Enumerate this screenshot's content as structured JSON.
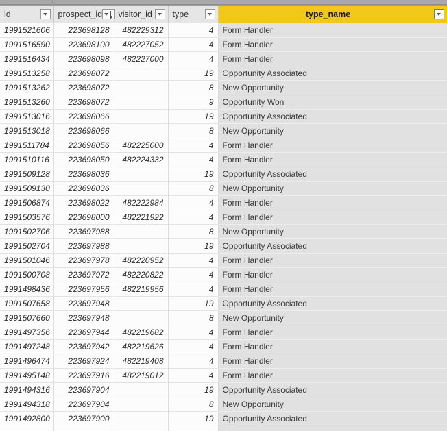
{
  "window": {
    "top_bar_segments": [
      "tab-strip-left",
      "tab-strip-right"
    ]
  },
  "grid": {
    "columns": [
      {
        "key": "id",
        "label": "id",
        "align": "right",
        "italic": true,
        "filter_icon": "filter-caret-icon",
        "highlighted": false
      },
      {
        "key": "prospect_id",
        "label": "prospect_id",
        "align": "right",
        "italic": true,
        "filter_icon": "filter-sort-descending-icon",
        "highlighted": false
      },
      {
        "key": "visitor_id",
        "label": "visitor_id",
        "align": "right",
        "italic": true,
        "filter_icon": "filter-caret-icon",
        "highlighted": false
      },
      {
        "key": "type",
        "label": "type",
        "align": "right",
        "italic": true,
        "filter_icon": "filter-caret-icon",
        "highlighted": false
      },
      {
        "key": "type_name",
        "label": "type_name",
        "align": "left",
        "italic": false,
        "filter_icon": "filter-caret-icon",
        "highlighted": true
      }
    ],
    "highlight_color": "#f0c817",
    "header_color": "#e6e6e6",
    "selected_column_cell_color": "#e1e1e1",
    "rows": [
      {
        "id": "1991521606",
        "prospect_id": "223698128",
        "visitor_id": "482229312",
        "type": "4",
        "type_name": "Form Handler"
      },
      {
        "id": "1991516590",
        "prospect_id": "223698100",
        "visitor_id": "482227052",
        "type": "4",
        "type_name": "Form Handler"
      },
      {
        "id": "1991516434",
        "prospect_id": "223698098",
        "visitor_id": "482227000",
        "type": "4",
        "type_name": "Form Handler"
      },
      {
        "id": "1991513258",
        "prospect_id": "223698072",
        "visitor_id": "",
        "type": "19",
        "type_name": "Opportunity Associated"
      },
      {
        "id": "1991513262",
        "prospect_id": "223698072",
        "visitor_id": "",
        "type": "8",
        "type_name": "New Opportunity"
      },
      {
        "id": "1991513260",
        "prospect_id": "223698072",
        "visitor_id": "",
        "type": "9",
        "type_name": "Opportunity Won"
      },
      {
        "id": "1991513016",
        "prospect_id": "223698066",
        "visitor_id": "",
        "type": "19",
        "type_name": "Opportunity Associated"
      },
      {
        "id": "1991513018",
        "prospect_id": "223698066",
        "visitor_id": "",
        "type": "8",
        "type_name": "New Opportunity"
      },
      {
        "id": "1991511784",
        "prospect_id": "223698056",
        "visitor_id": "482225000",
        "type": "4",
        "type_name": "Form Handler"
      },
      {
        "id": "1991510116",
        "prospect_id": "223698050",
        "visitor_id": "482224332",
        "type": "4",
        "type_name": "Form Handler"
      },
      {
        "id": "1991509128",
        "prospect_id": "223698036",
        "visitor_id": "",
        "type": "19",
        "type_name": "Opportunity Associated"
      },
      {
        "id": "1991509130",
        "prospect_id": "223698036",
        "visitor_id": "",
        "type": "8",
        "type_name": "New Opportunity"
      },
      {
        "id": "1991506874",
        "prospect_id": "223698022",
        "visitor_id": "482222984",
        "type": "4",
        "type_name": "Form Handler"
      },
      {
        "id": "1991503576",
        "prospect_id": "223698000",
        "visitor_id": "482221922",
        "type": "4",
        "type_name": "Form Handler"
      },
      {
        "id": "1991502706",
        "prospect_id": "223697988",
        "visitor_id": "",
        "type": "8",
        "type_name": "New Opportunity"
      },
      {
        "id": "1991502704",
        "prospect_id": "223697988",
        "visitor_id": "",
        "type": "19",
        "type_name": "Opportunity Associated"
      },
      {
        "id": "1991501046",
        "prospect_id": "223697978",
        "visitor_id": "482220952",
        "type": "4",
        "type_name": "Form Handler"
      },
      {
        "id": "1991500708",
        "prospect_id": "223697972",
        "visitor_id": "482220822",
        "type": "4",
        "type_name": "Form Handler"
      },
      {
        "id": "1991498436",
        "prospect_id": "223697956",
        "visitor_id": "482219956",
        "type": "4",
        "type_name": "Form Handler"
      },
      {
        "id": "1991507658",
        "prospect_id": "223697948",
        "visitor_id": "",
        "type": "19",
        "type_name": "Opportunity Associated"
      },
      {
        "id": "1991507660",
        "prospect_id": "223697948",
        "visitor_id": "",
        "type": "8",
        "type_name": "New Opportunity"
      },
      {
        "id": "1991497356",
        "prospect_id": "223697944",
        "visitor_id": "482219682",
        "type": "4",
        "type_name": "Form Handler"
      },
      {
        "id": "1991497248",
        "prospect_id": "223697942",
        "visitor_id": "482219626",
        "type": "4",
        "type_name": "Form Handler"
      },
      {
        "id": "1991496474",
        "prospect_id": "223697924",
        "visitor_id": "482219408",
        "type": "4",
        "type_name": "Form Handler"
      },
      {
        "id": "1991495148",
        "prospect_id": "223697916",
        "visitor_id": "482219012",
        "type": "4",
        "type_name": "Form Handler"
      },
      {
        "id": "1991494316",
        "prospect_id": "223697904",
        "visitor_id": "",
        "type": "19",
        "type_name": "Opportunity Associated"
      },
      {
        "id": "1991494318",
        "prospect_id": "223697904",
        "visitor_id": "",
        "type": "8",
        "type_name": "New Opportunity"
      },
      {
        "id": "1991492800",
        "prospect_id": "223697900",
        "visitor_id": "",
        "type": "19",
        "type_name": "Opportunity Associated"
      }
    ]
  }
}
